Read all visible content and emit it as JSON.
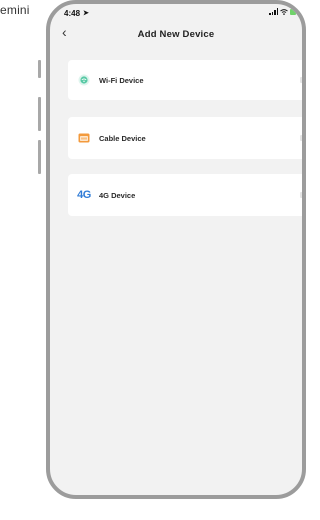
{
  "overlay": {
    "corner_text": "emini"
  },
  "status_bar": {
    "time": "4:48",
    "location_glyph": "➤"
  },
  "nav": {
    "back_glyph": "‹",
    "title": "Add New Device"
  },
  "devices": [
    {
      "label": "Wi-Fi Device",
      "icon": "wifi-device-icon"
    },
    {
      "label": "Cable Device",
      "icon": "cable-device-icon"
    },
    {
      "label": "4G Device",
      "icon": "4g-device-icon",
      "icon_text": "4G"
    }
  ],
  "colors": {
    "wifi": "#58c9a5",
    "cable": "#f39a3c",
    "fourg": "#2f7bd6",
    "battery": "#6fd26a"
  }
}
